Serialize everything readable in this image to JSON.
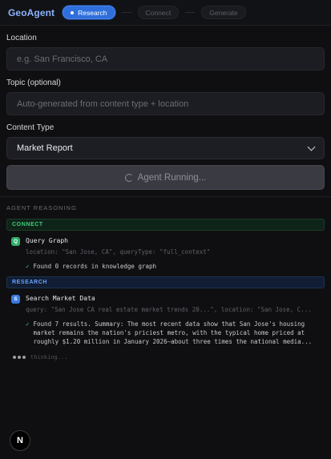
{
  "header": {
    "logo": "GeoAgent",
    "steps": [
      {
        "label": "Research",
        "active": true
      },
      {
        "label": "Connect",
        "active": false
      },
      {
        "label": "Generate",
        "active": false
      }
    ]
  },
  "form": {
    "location": {
      "label": "Location",
      "placeholder": "e.g. San Francisco, CA"
    },
    "topic": {
      "label": "Topic (optional)",
      "placeholder": "Auto-generated from content type + location"
    },
    "content_type": {
      "label": "Content Type",
      "value": "Market Report"
    },
    "run_button": {
      "label": "Agent Running..."
    }
  },
  "reasoning": {
    "title": "AGENT REASONING",
    "phases": {
      "connect": "CONNECT",
      "research": "RESEARCH"
    },
    "query_graph": {
      "badge": "Q",
      "name": "Query Graph",
      "args": "location: \"San Jose, CA\", queryType: \"full_context\"",
      "check": "✓",
      "result": "Found 0 records in knowledge graph"
    },
    "search_market": {
      "badge": "S",
      "name": "Search Market Data",
      "args": "query: \"San Jose CA real estate market trends 20...\", location: \"San Jose, C...",
      "check": "✓",
      "result": "Found 7 results. Summary: The most recent data show that San Jose's housing market remains the nation's priciest metro, with the typical home priced at roughly $1.20 million in January 2026—about three times the national media..."
    },
    "thinking": "thinking..."
  },
  "footer": {
    "n_button": "N"
  },
  "colors": {
    "background": "#0f0f11",
    "accent": "#2f6fdc",
    "connect_green": "#3ecf7a",
    "research_blue": "#6aa2ff"
  }
}
